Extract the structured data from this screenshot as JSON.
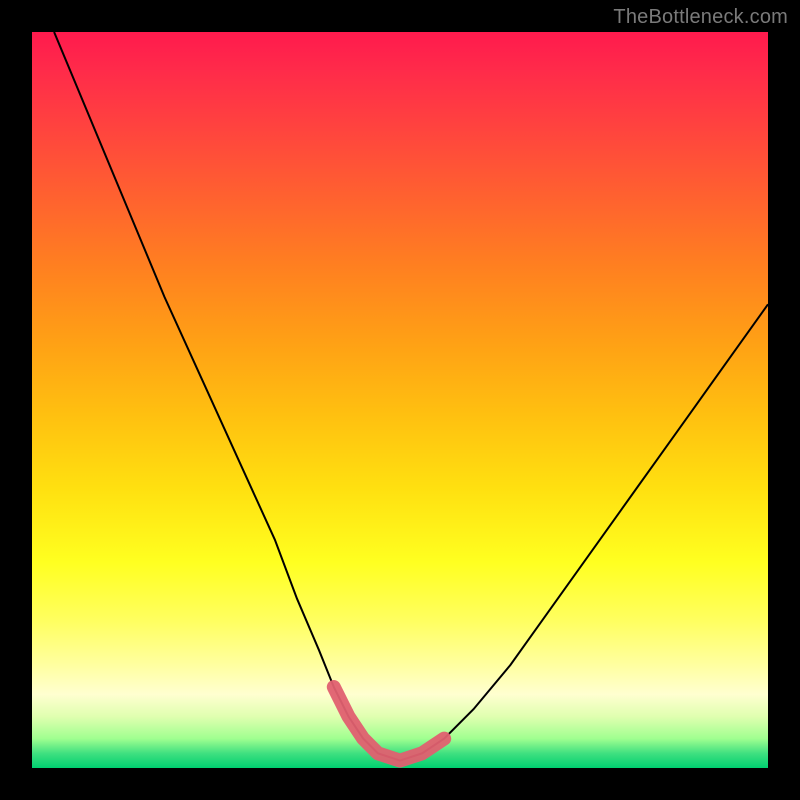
{
  "watermark": "TheBottleneck.com",
  "chart_data": {
    "type": "line",
    "title": "",
    "xlabel": "",
    "ylabel": "",
    "xlim": [
      0,
      100
    ],
    "ylim": [
      0,
      100
    ],
    "axes_visible": false,
    "background": "rainbow-gradient-vertical",
    "series": [
      {
        "name": "bottleneck-curve",
        "x": [
          3,
          8,
          13,
          18,
          23,
          28,
          33,
          36,
          39,
          41,
          43,
          45,
          47,
          50,
          53,
          56,
          60,
          65,
          70,
          75,
          80,
          85,
          90,
          95,
          100
        ],
        "y": [
          100,
          88,
          76,
          64,
          53,
          42,
          31,
          23,
          16,
          11,
          7,
          4,
          2,
          1,
          2,
          4,
          8,
          14,
          21,
          28,
          35,
          42,
          49,
          56,
          63
        ]
      }
    ],
    "highlight": {
      "name": "optimal-range",
      "x_range": [
        39,
        58
      ],
      "y_max": 12,
      "color": "#e06070"
    }
  }
}
